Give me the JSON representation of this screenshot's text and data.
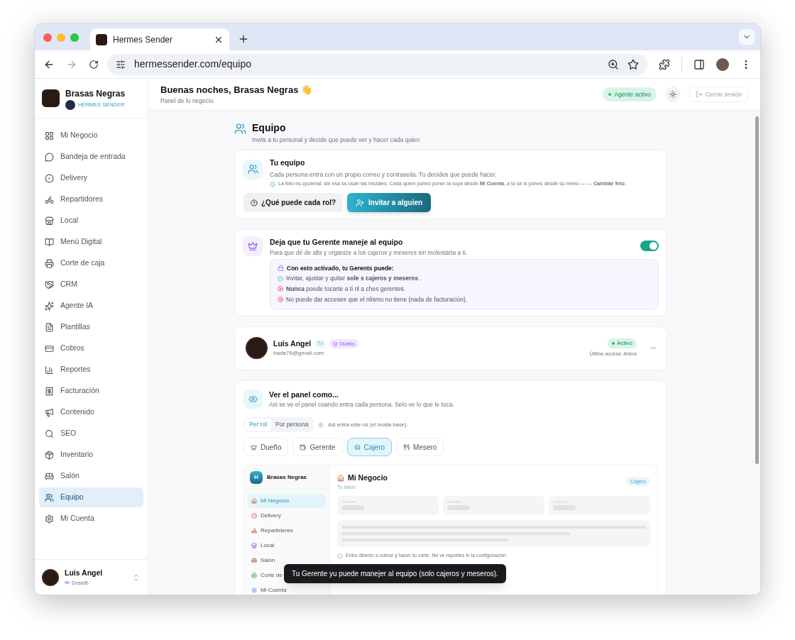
{
  "browser": {
    "tab_title": "Hermes Sender",
    "url": "hermessender.com/equipo"
  },
  "sidebar": {
    "brand": "Brasas Negras",
    "product": "HERMES SENDER",
    "items": [
      {
        "kind": "grid",
        "label": "Mi Negocio",
        "selected": false
      },
      {
        "kind": "inbox",
        "label": "Bandeja de entrada",
        "selected": false
      },
      {
        "kind": "delivery",
        "label": "Delivery",
        "selected": false
      },
      {
        "kind": "bike",
        "label": "Repartidores",
        "selected": false
      },
      {
        "kind": "store",
        "label": "Local",
        "selected": false
      },
      {
        "kind": "book",
        "label": "Menú Digital",
        "selected": false
      },
      {
        "kind": "register",
        "label": "Corte de caja",
        "selected": false
      },
      {
        "kind": "crm",
        "label": "CRM",
        "selected": false
      },
      {
        "kind": "sparkle",
        "label": "Agente IA",
        "selected": false
      },
      {
        "kind": "file",
        "label": "Plantillas",
        "selected": false
      },
      {
        "kind": "card",
        "label": "Cobros",
        "selected": false
      },
      {
        "kind": "chart",
        "label": "Reportes",
        "selected": false
      },
      {
        "kind": "receipt",
        "label": "Facturación",
        "selected": false
      },
      {
        "kind": "megaphone",
        "label": "Contenido",
        "selected": false
      },
      {
        "kind": "search",
        "label": "SEO",
        "selected": false
      },
      {
        "kind": "box",
        "label": "Inventario",
        "selected": false
      },
      {
        "kind": "sofa",
        "label": "Salón",
        "selected": false
      },
      {
        "kind": "team",
        "label": "Equipo",
        "selected": true
      },
      {
        "kind": "gear",
        "label": "Mi Cuenta",
        "selected": false
      }
    ],
    "user": {
      "name": "Luis Angel",
      "role": "Dosetb"
    }
  },
  "header": {
    "greeting": "Buenas noches, Brasas Negras 👋",
    "subtitle": "Panel de lu negecio",
    "status": "Agente activo",
    "logout": "Cerrar sesión"
  },
  "page": {
    "title": "Equipo",
    "subtitle": "Invits a tu personal y decide que puede ver y hacer cada quien"
  },
  "team_card": {
    "title": "Tu equipo",
    "description": "Cada persona entra con un propio correo y contraseila. Tu decides que puede hacer.",
    "note": "La foto es opcienal: sin esa ss usan las iniciales. Cada quien ponez poner ia suya desde **Mi Cuenta**, a to se ls pones desde su menú — — **Cambiar feto.**",
    "buttons": [
      {
        "kind": "secondary",
        "label": "¿Qué puede cada rol?"
      },
      {
        "kind": "primary",
        "label": "Invitar a alguien"
      }
    ]
  },
  "manager_card": {
    "title": "Deja que tu Gerente maneje al equipo",
    "description": "Para que dé de alts y organize a los cajeros y meseres sin molestarta a ti.",
    "on": true,
    "box_title": "Con esto activado, tu Gerents puede:",
    "rules": [
      {
        "kind": "allowed",
        "text": "Invitar, ajustar y quitar  **sole s cajeros y meseros**  ."
      },
      {
        "kind": "denied",
        "text": "**Nunca** poede tocarte a ti nl a ches gerentes."
      },
      {
        "kind": "denied",
        "text": "No puede dar acceses que el nlismo no tiene (nada de facturación)."
      }
    ]
  },
  "member": {
    "name": "Luis Angel",
    "you_badge": "Tú",
    "role": "Duelio",
    "email": "hada76@gmail.com",
    "status": "Activo",
    "last_access": "Últime accese: Ahera"
  },
  "preview_card": {
    "title": "Ver el panel como...",
    "description": "Asi se ve el panel cuando entra cada persona. Selo ve lo que le toca.",
    "modes": [
      {
        "label": "Per rol",
        "selected": true
      },
      {
        "label": "Por persona",
        "selected": false
      }
    ],
    "hint": "Asi entra este rol (el molde base).",
    "roles": [
      {
        "kind": "owner",
        "label": "Dueño",
        "selected": false
      },
      {
        "kind": "manager",
        "label": "Gerente",
        "selected": false
      },
      {
        "kind": "cashier",
        "label": "Cajero",
        "selected": true
      },
      {
        "kind": "waiter",
        "label": "Mesero",
        "selected": false
      }
    ],
    "preview": {
      "initial": "H",
      "brand": "Brasas Negras",
      "nav": [
        {
          "kind": "home",
          "label": "Mi Negocio",
          "selected": true
        },
        {
          "kind": "delivery",
          "label": "Delivery",
          "selected": false
        },
        {
          "kind": "bike",
          "label": "Repartideres",
          "selected": false
        },
        {
          "kind": "store",
          "label": "Local",
          "selected": false
        },
        {
          "kind": "sofa",
          "label": "Saión",
          "selected": false
        },
        {
          "kind": "register",
          "label": "Corte de",
          "selected": false
        },
        {
          "kind": "gear",
          "label": "Mi Cuenta",
          "selected": false
        }
      ],
      "title": "Mi Negocio",
      "subtitle": "Tu inicio",
      "role_badge": "Cajero",
      "note": "Entro directo a cobrar y hacer tu corte. Ne ve reportes in la configuración."
    }
  },
  "toast": "Tu Gerente yu puede manejer al equipo (solo cajeros y meseros)."
}
